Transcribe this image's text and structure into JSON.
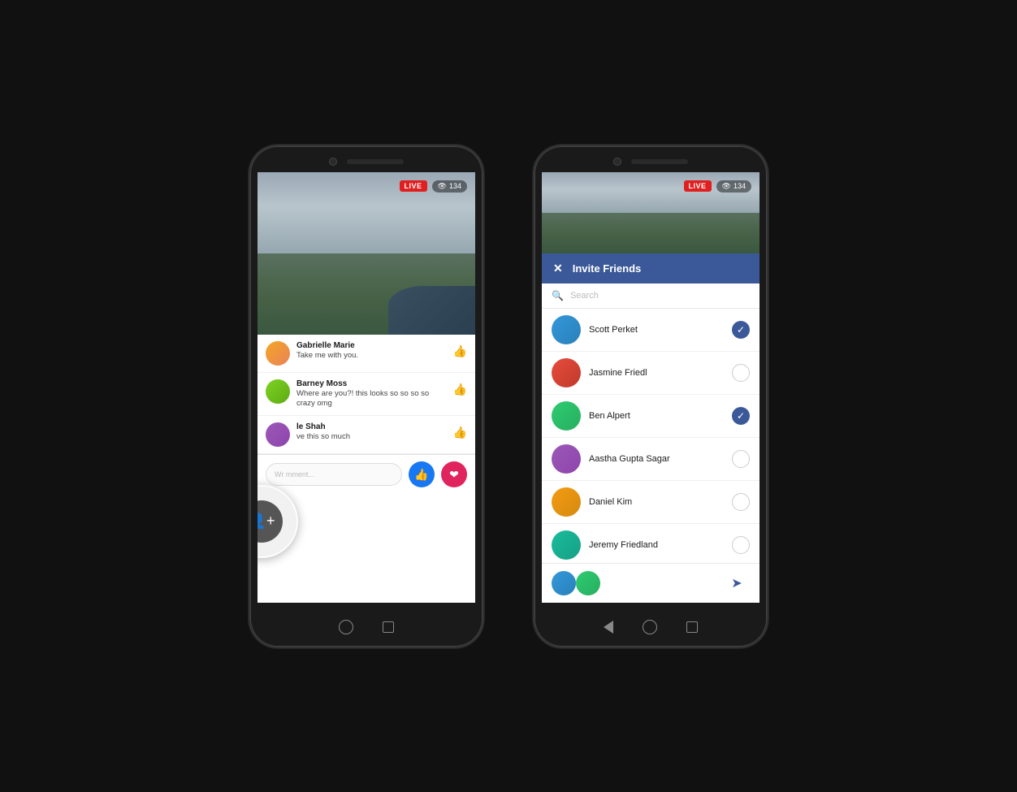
{
  "page": {
    "background": "#111111"
  },
  "phone_left": {
    "aerial": {
      "live_badge": "LIVE",
      "viewer_count": "134"
    },
    "comments": [
      {
        "name": "Gabrielle Marie",
        "text": "Take me with you.",
        "avatar_class": "avatar-1"
      },
      {
        "name": "Barney Moss",
        "text": "Where are you?! this looks so so so so crazy omg",
        "avatar_class": "avatar-2"
      },
      {
        "name": "le Shah",
        "text": "ve this so much",
        "avatar_class": "avatar-3"
      }
    ],
    "comment_placeholder": "Wr mment...",
    "nav": {
      "home": "○",
      "square": "□"
    }
  },
  "phone_right": {
    "aerial": {
      "live_badge": "LIVE",
      "viewer_count": "134"
    },
    "invite": {
      "close_icon": "✕",
      "title": "Invite Friends",
      "search_placeholder": "Search"
    },
    "friends": [
      {
        "name": "Scott Perket",
        "selected": true,
        "avatar_class": "fa-1"
      },
      {
        "name": "Jasmine Friedl",
        "selected": false,
        "avatar_class": "fa-2"
      },
      {
        "name": "Ben Alpert",
        "selected": true,
        "avatar_class": "fa-3"
      },
      {
        "name": "Aastha Gupta Sagar",
        "selected": false,
        "avatar_class": "fa-4"
      },
      {
        "name": "Daniel Kim",
        "selected": false,
        "avatar_class": "fa-5"
      },
      {
        "name": "Jeremy Friedland",
        "selected": false,
        "avatar_class": "fa-6"
      }
    ],
    "nav": {
      "back": "◁",
      "home": "○",
      "square": "□"
    }
  }
}
